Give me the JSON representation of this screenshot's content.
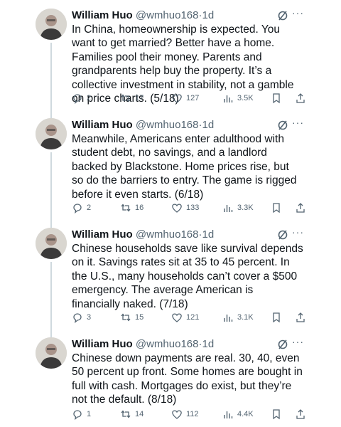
{
  "tweets": [
    {
      "author": "William Huo",
      "handle": "@wmhuo168",
      "separator": "·",
      "time": "1d",
      "text": "In China, homeownership is expected. You want to get married? Better have a home. Families pool their money. Parents and grandparents help buy the property. It’s a collective investment in stability, not a gamble on price charts. (5/18)",
      "replies": "2",
      "reposts": "17",
      "likes": "127",
      "views": "3.5K"
    },
    {
      "author": "William Huo",
      "handle": "@wmhuo168",
      "separator": "·",
      "time": "1d",
      "text": "Meanwhile, Americans enter adulthood with student debt, no savings, and a landlord backed by Blackstone. Home prices rise, but so do the barriers to entry. The game is rigged before it even starts. (6/18)",
      "replies": "2",
      "reposts": "16",
      "likes": "133",
      "views": "3.3K"
    },
    {
      "author": "William Huo",
      "handle": "@wmhuo168",
      "separator": "·",
      "time": "1d",
      "text": "Chinese households save like survival depends on it. Savings rates sit at 35 to 45 percent. In the U.S., many households can’t cover a $500 emergency. The average American is financially naked. (7/18)",
      "replies": "3",
      "reposts": "15",
      "likes": "121",
      "views": "3.1K"
    },
    {
      "author": "William Huo",
      "handle": "@wmhuo168",
      "separator": "·",
      "time": "1d",
      "text": "Chinese down payments are real. 30, 40, even 50 percent up front. Some homes are bought in full with cash. Mortgages do exist, but they’re not the default. (8/18)",
      "replies": "1",
      "reposts": "14",
      "likes": "112",
      "views": "4.4K"
    }
  ],
  "icons": {
    "grok": "grok-icon",
    "more": "more-icon",
    "reply": "reply-icon",
    "repost": "repost-icon",
    "like": "like-icon",
    "views": "views-icon",
    "bookmark": "bookmark-icon",
    "share": "share-icon"
  },
  "colors": {
    "text": "#0f1419",
    "secondary": "#536471",
    "thread_line": "#cfd9de"
  }
}
